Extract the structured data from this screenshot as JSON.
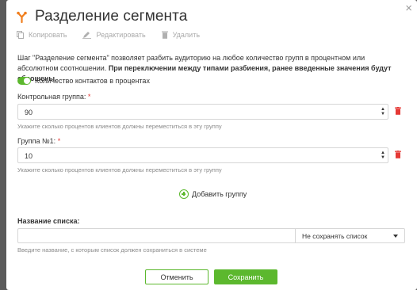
{
  "dialog": {
    "title": "Разделение сегмента",
    "close_glyph": "×"
  },
  "toolbar": {
    "copy_label": "Копировать",
    "edit_label": "Редактировать",
    "delete_label": "Удалить"
  },
  "description": {
    "text": "Шаг \"Разделение сегмента\" позволяет разбить аудиторию на любое количество групп в процентном или абсолютном соотношении. ",
    "bold": "При переключении между типами разбиения, ранее введенные значения будут сброшены."
  },
  "toggle": {
    "label": "Количество контактов в процентах",
    "on": true
  },
  "groups": [
    {
      "label": "Контрольная группа:",
      "required_mark": "*",
      "value": "90",
      "hint": "Укажите сколько процентов клиентов должны переместиться в эту группу"
    },
    {
      "label": "Группа №1:",
      "required_mark": "*",
      "value": "10",
      "hint": "Укажите сколько процентов клиентов должны переместиться в эту группу"
    }
  ],
  "add_group_label": "Добавить группу",
  "list": {
    "label": "Название списка:",
    "value": "",
    "select_value": "Не сохранять список",
    "hint": "Введите название, с которым список должен сохраниться в системе"
  },
  "buttons": {
    "cancel": "Отменить",
    "save": "Сохранить"
  },
  "colors": {
    "accent": "#5cb82e",
    "danger": "#e53935",
    "logo": "#f07f1f"
  },
  "icons": [
    "split-logo-icon",
    "copy-icon",
    "edit-icon",
    "trash-icon",
    "plus-circle-icon",
    "chevron-down-icon",
    "close-icon"
  ]
}
